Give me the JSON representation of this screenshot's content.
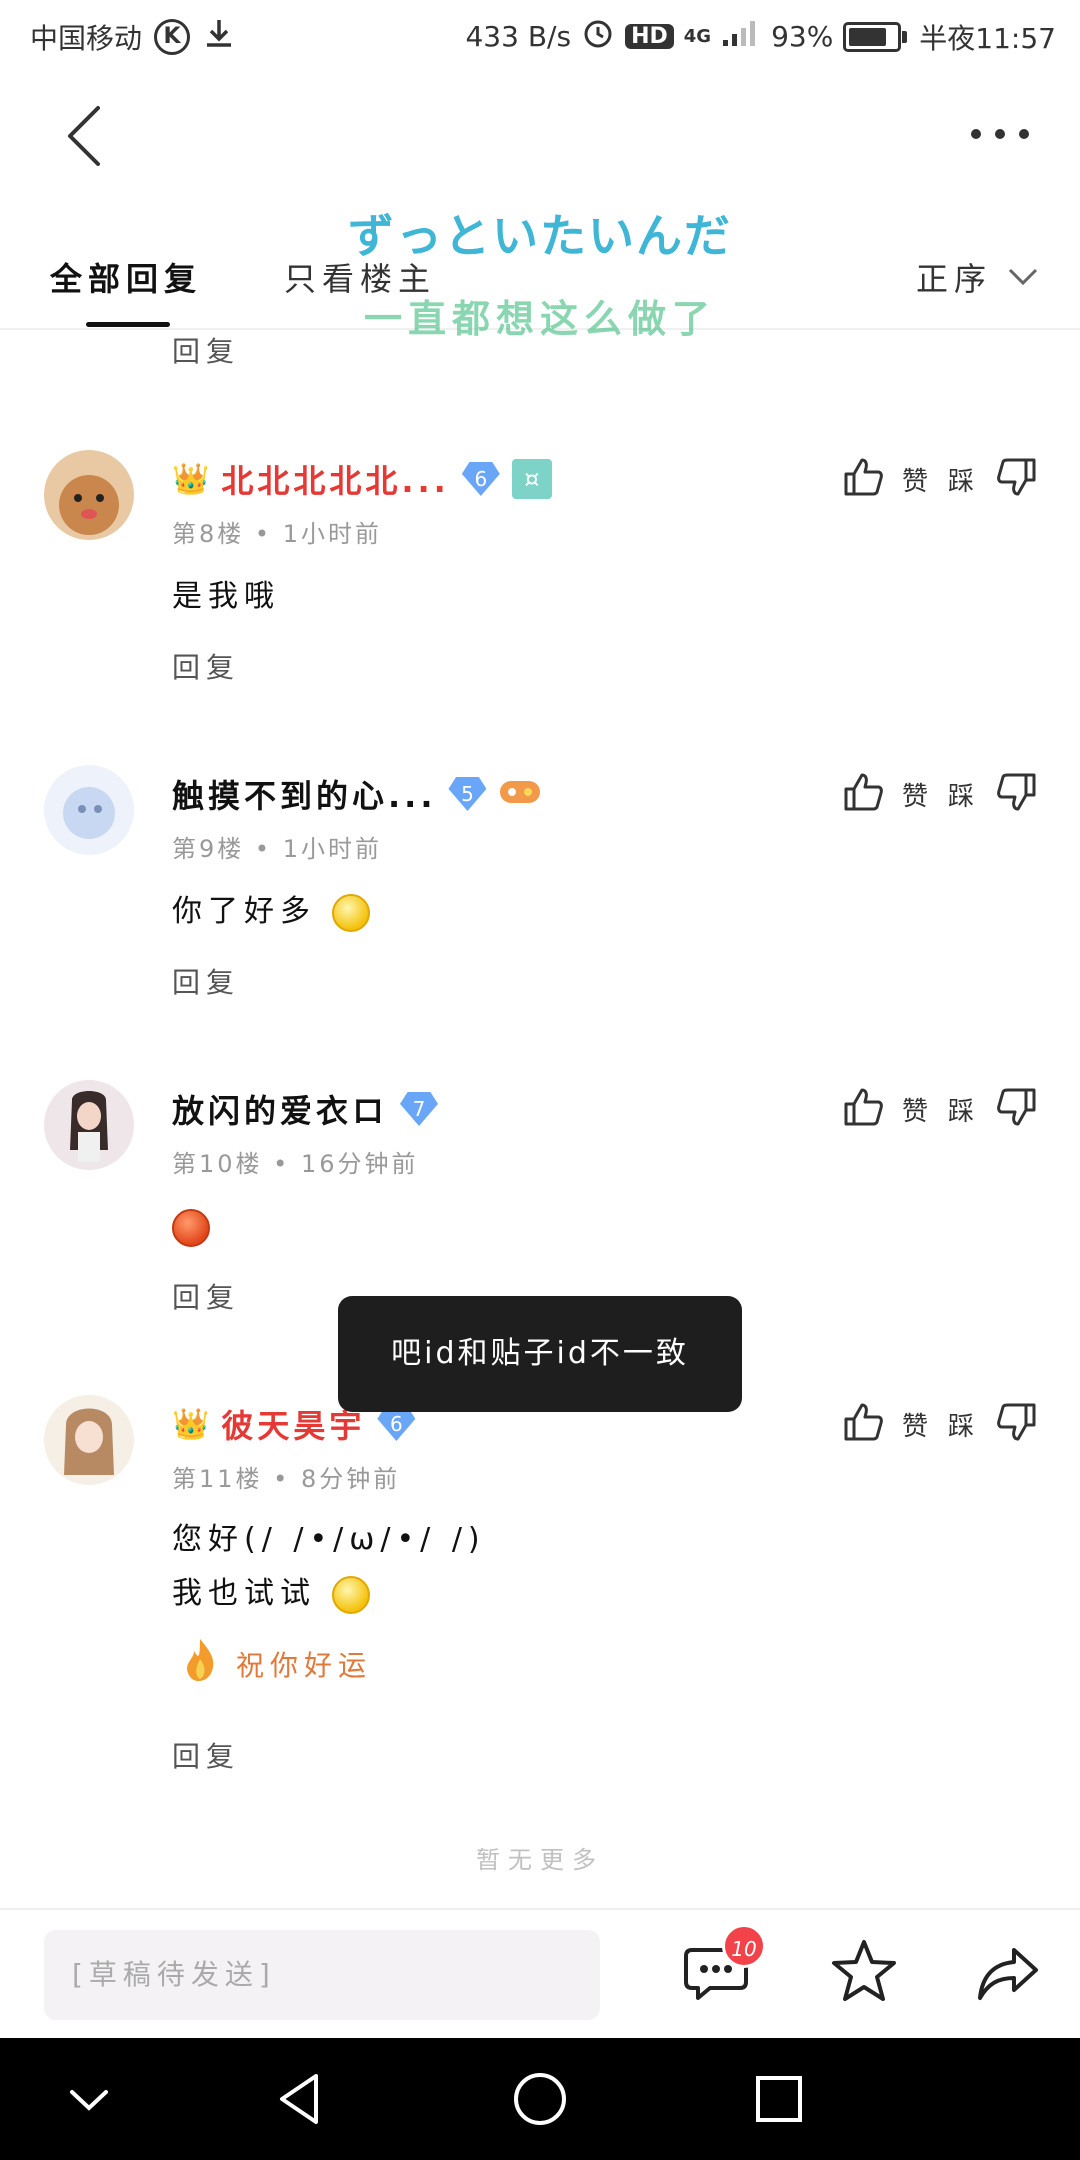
{
  "status_bar": {
    "carrier": "中国移动",
    "k_badge": "K",
    "net_speed": "433 B/s",
    "hd": "HD",
    "network": "4G",
    "battery_text": "93%",
    "battery_level": 0.93,
    "time": "半夜11:57"
  },
  "overlay": {
    "jp": "ずっといたいんだ",
    "cn": "一直都想这么做了"
  },
  "tabs": {
    "all": "全部回复",
    "owner_only": "只看楼主",
    "sort": "正序"
  },
  "reply_label": "回复",
  "posts": [
    {
      "name": "北北北北北...",
      "level": "6",
      "floor": "第8楼",
      "time": "1小时前",
      "text": "是我哦",
      "like": "赞",
      "dislike": "踩"
    },
    {
      "name": "触摸不到的心...",
      "level": "5",
      "floor": "第9楼",
      "time": "1小时前",
      "text": "你了好多",
      "like": "赞",
      "dislike": "踩"
    },
    {
      "name": "放闪的爱衣ロ",
      "level": "7",
      "floor": "第10楼",
      "time": "16分钟前",
      "text": "",
      "like": "赞",
      "dislike": "踩"
    },
    {
      "name": "彼天昊宇",
      "level": "6",
      "floor": "第11楼",
      "time": "8分钟前",
      "text_line1": "您好(/ /•/ω/•/ /)",
      "text_line2": "我也试试",
      "luck": "祝你好运",
      "like": "赞",
      "dislike": "踩"
    }
  ],
  "toast": "吧id和贴子id不一致",
  "no_more": "暂无更多",
  "bottom_bar": {
    "draft_placeholder": "[草稿待发送]",
    "comment_count": "10"
  },
  "icons": [
    "back-icon",
    "more-icon",
    "chevron-down-icon",
    "thumb-up-icon",
    "thumb-down-icon",
    "comment-icon",
    "star-icon",
    "share-icon",
    "nav-down-icon",
    "nav-back-icon",
    "nav-home-icon",
    "nav-recent-icon"
  ]
}
